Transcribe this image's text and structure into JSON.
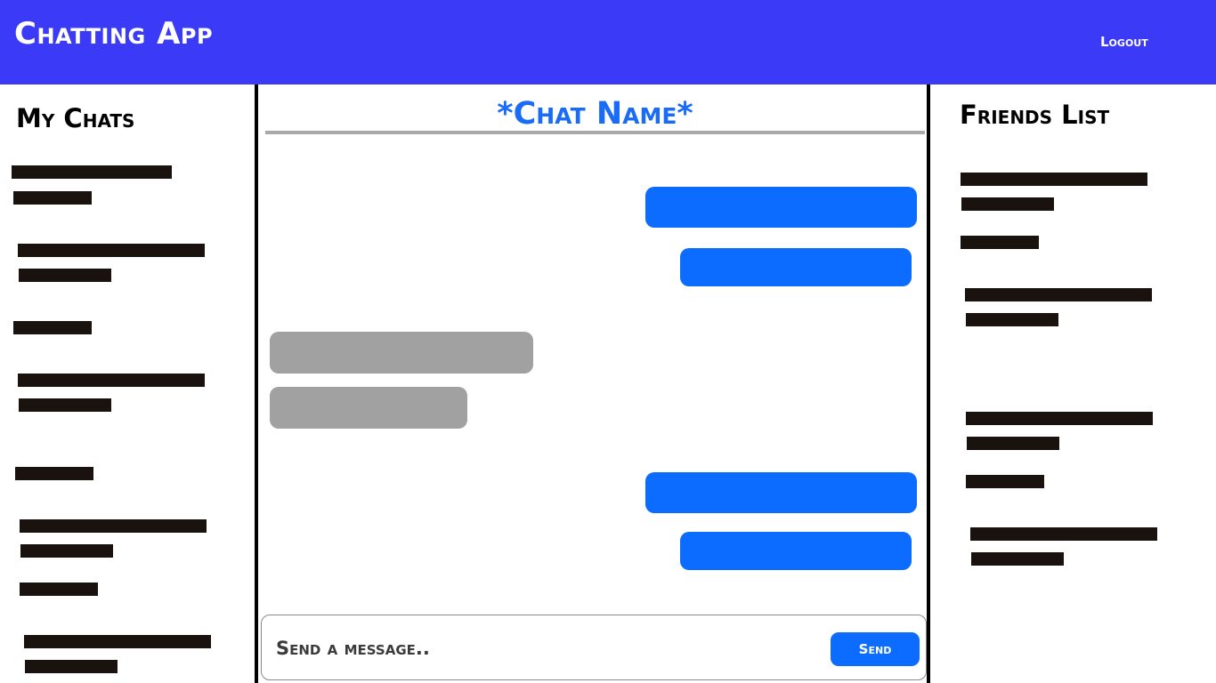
{
  "header": {
    "app_title": "Chatting App",
    "logout_label": "Logout",
    "background_color": "#3a3af7"
  },
  "my_chats": {
    "title": "My Chats",
    "items": [
      {
        "label": "redacted"
      },
      {
        "label": "redacted"
      },
      {
        "label": "redacted"
      },
      {
        "label": "redacted"
      },
      {
        "label": "redacted"
      },
      {
        "label": "redacted"
      },
      {
        "label": "redacted"
      },
      {
        "label": "redacted"
      }
    ]
  },
  "chat": {
    "name": "*Chat Name*",
    "name_color": "#1a6cf7",
    "messages": [
      {
        "from": "me"
      },
      {
        "from": "me"
      },
      {
        "from": "friend"
      },
      {
        "from": "friend"
      },
      {
        "from": "me"
      },
      {
        "from": "me"
      }
    ],
    "sent_color": "#0b6cff",
    "received_color": "#a1a1a1"
  },
  "composer": {
    "placeholder": "Send a message..",
    "value": "",
    "send_label": "Send"
  },
  "friends": {
    "title": "Friends List",
    "items": [
      {
        "label": "redacted"
      },
      {
        "label": "redacted"
      },
      {
        "label": "redacted"
      },
      {
        "label": "redacted"
      },
      {
        "label": "redacted"
      },
      {
        "label": "redacted"
      }
    ]
  }
}
